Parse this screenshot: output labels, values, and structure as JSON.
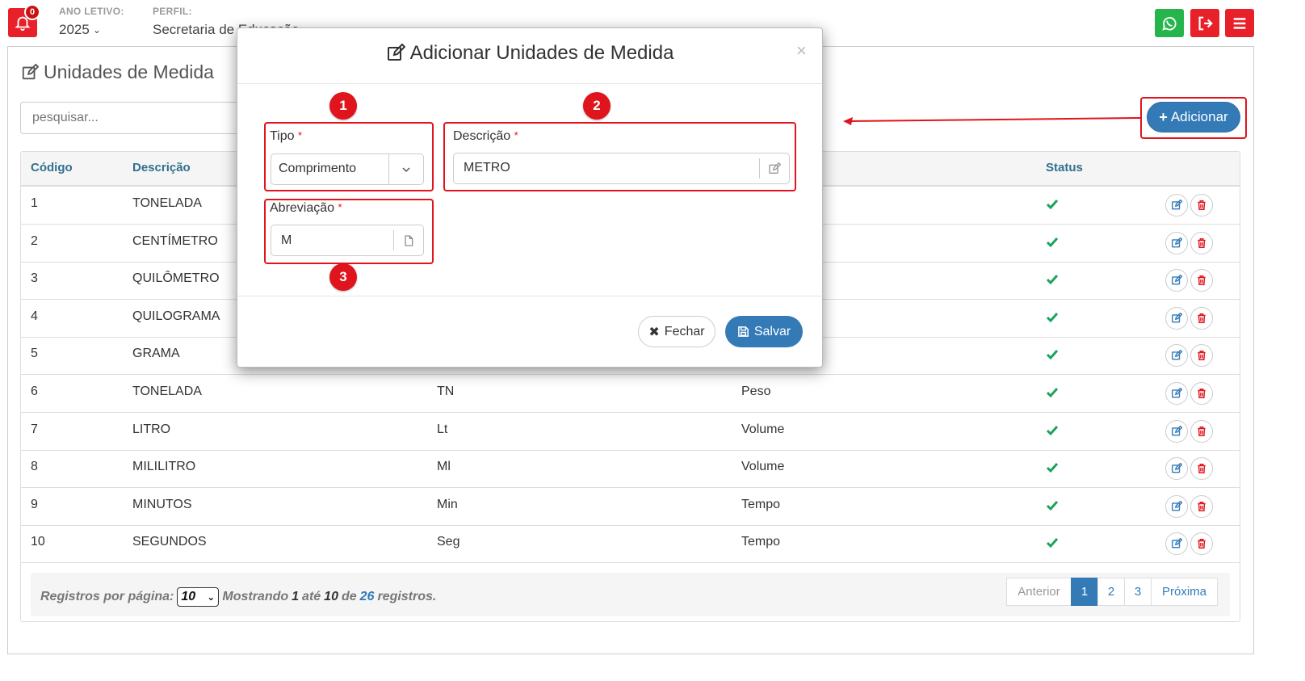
{
  "topbar": {
    "notifications_count": "0",
    "ano_letivo_label": "ANO LETIVO:",
    "ano_letivo_value": "2025",
    "perfil_label": "PERFIL:",
    "perfil_value": "Secretaria de Educação"
  },
  "page": {
    "title": "Unidades de Medida",
    "search_placeholder": "pesquisar...",
    "add_label": "Adicionar"
  },
  "table": {
    "headers": {
      "codigo": "Código",
      "descricao": "Descrição",
      "status": "Status"
    },
    "rows": [
      {
        "codigo": "1",
        "descricao": "TONELADA",
        "abrev": "",
        "tipo": ""
      },
      {
        "codigo": "2",
        "descricao": "CENTÍMETRO",
        "abrev": "",
        "tipo": ""
      },
      {
        "codigo": "3",
        "descricao": "QUILÔMETRO",
        "abrev": "",
        "tipo": ""
      },
      {
        "codigo": "4",
        "descricao": "QUILOGRAMA",
        "abrev": "",
        "tipo": ""
      },
      {
        "codigo": "5",
        "descricao": "GRAMA",
        "abrev": "",
        "tipo": ""
      },
      {
        "codigo": "6",
        "descricao": "TONELADA",
        "abrev": "TN",
        "tipo": "Peso"
      },
      {
        "codigo": "7",
        "descricao": "LITRO",
        "abrev": "Lt",
        "tipo": "Volume"
      },
      {
        "codigo": "8",
        "descricao": "MILILITRO",
        "abrev": "Ml",
        "tipo": "Volume"
      },
      {
        "codigo": "9",
        "descricao": "MINUTOS",
        "abrev": "Min",
        "tipo": "Tempo"
      },
      {
        "codigo": "10",
        "descricao": "SEGUNDOS",
        "abrev": "Seg",
        "tipo": "Tempo"
      }
    ]
  },
  "footer": {
    "per_page_label": "Registros por página:",
    "per_page_value": "10",
    "showing_label": "Mostrando",
    "from": "1",
    "ate": "até",
    "to": "10",
    "de": "de",
    "total": "26",
    "registros": "registros."
  },
  "pagination": {
    "prev": "Anterior",
    "pages": [
      "1",
      "2",
      "3"
    ],
    "next": "Próxima"
  },
  "modal": {
    "title": "Adicionar Unidades de Medida",
    "close": "×",
    "tipo_label": "Tipo",
    "tipo_value": "Comprimento",
    "descricao_label": "Descrição",
    "descricao_value": "METRO",
    "abreviacao_label": "Abreviação",
    "abreviacao_value": "M",
    "required_mark": "*",
    "fechar_label": "Fechar",
    "salvar_label": "Salvar"
  },
  "annotations": [
    "1",
    "2",
    "3"
  ],
  "colors": {
    "primary": "#337ab7",
    "danger": "#e0141c",
    "success": "#1ba35a",
    "whatsapp": "#25b54a"
  }
}
